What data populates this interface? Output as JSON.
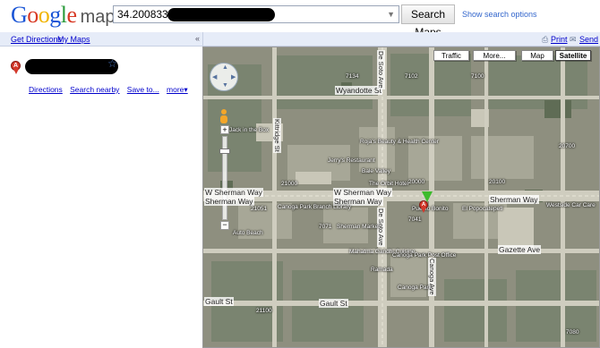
{
  "header": {
    "logo_text_google": "Google",
    "logo_text_maps": "maps",
    "search_value": "34.200833,-",
    "search_button": "Search Maps",
    "show_search_options": "Show search options"
  },
  "left_panel": {
    "get_directions": "Get Directions",
    "my_maps": "My Maps",
    "collapse_glyph": "«",
    "result": {
      "marker_letter": "A",
      "links": [
        "Directions",
        "Search nearby",
        "Save to...",
        "more▾"
      ]
    }
  },
  "map_header": {
    "print": "Print",
    "send": "Send"
  },
  "map_controls": {
    "traffic": "Traffic",
    "more": "More...",
    "map": "Map",
    "satellite": "Satellite",
    "active": "Satellite",
    "zoom_plus": "+",
    "zoom_minus": "−"
  },
  "map_labels": {
    "wyandotte": "Wyandotte St",
    "desoto_top": "De Soto Ave",
    "desoto_bottom": "De Soto Ave",
    "sherman_left": "W Sherman Way",
    "sherman_left2": "Sherman Way",
    "sherman_mid": "W Sherman Way",
    "sherman_mid2": "Sherman Way",
    "sherman_right": "Sherman Way",
    "gazette": "Gazette Ave",
    "gault": "Gault St",
    "gault_mid": "Gault St",
    "canoga": "Canoga Ave",
    "kittridge": "Kittridge St",
    "places": [
      "Roja's Beauty & Health Center",
      "Jerry's Restaurant",
      "Bale Valley",
      "Canoga Park Branch Library",
      "Auto Beach",
      "Jack in the Box",
      "Pueblo Bonito",
      "El Popocatepetl",
      "Mahatma Gandhi Cuisine",
      "Canoga Park Post Office",
      "Sherman Market",
      "Westside Car Care",
      "The Orbit Hotel",
      "Canoga Park",
      "Ramada"
    ],
    "numbers": [
      "7134",
      "7102",
      "7100",
      "20000",
      "20100",
      "21000",
      "7041",
      "21051",
      "21100",
      "20700",
      "7071",
      "7080"
    ]
  },
  "colors": {
    "accent_blue": "#1a55d6",
    "link": "#0000cc",
    "marker_red": "#d4392b",
    "marker_green": "#3dbb2e",
    "panel_bar": "#e6ecf8"
  }
}
